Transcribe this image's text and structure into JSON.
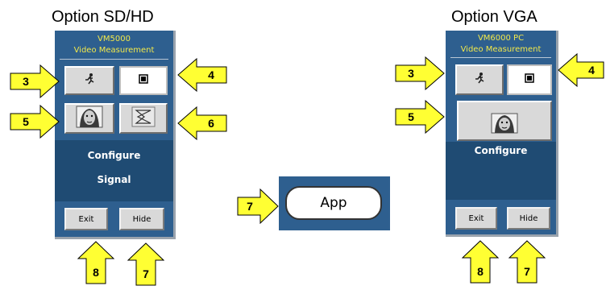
{
  "headings": {
    "left": "Option SD/HD",
    "right": "Option VGA"
  },
  "left_panel": {
    "title_line1": "VM5000",
    "title_line2": "Video Measurement",
    "menu": [
      "Configure",
      "Signal"
    ],
    "exit_label": "Exit",
    "hide_label": "Hide"
  },
  "right_panel": {
    "title_line1": "VM6000 PC",
    "title_line2": "Video Measurement",
    "menu": [
      "Configure"
    ],
    "exit_label": "Exit",
    "hide_label": "Hide"
  },
  "app_button": {
    "label": "App"
  },
  "callouts": {
    "l3": "3",
    "l4": "4",
    "l5": "5",
    "l6": "6",
    "l7_bottom": "7",
    "l8": "8",
    "app7": "7",
    "r3": "3",
    "r4": "4",
    "r5": "5",
    "r7": "7",
    "r8": "8"
  },
  "colors": {
    "panel": "#2e5f8f",
    "panel_dark": "#1f4b73",
    "title_text": "#f2e84a",
    "callout_fill": "#ffff33"
  }
}
